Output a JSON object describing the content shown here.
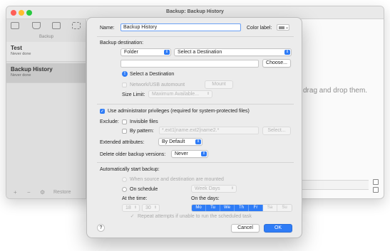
{
  "window": {
    "title": "Backup: Backup History",
    "sidebar_group": "Backup",
    "items": [
      {
        "name": "Test",
        "status": "Never done"
      },
      {
        "name": "Backup History",
        "status": "Never done"
      }
    ],
    "footer_restore": "Restore",
    "drop_hint": "drag and drop them.",
    "selected_color": "#c9c9c9"
  },
  "sheet": {
    "name_label": "Name:",
    "name_value": "Backup History",
    "color_label": "Color label:",
    "destination_label": "Backup destination:",
    "dest_type": "Folder",
    "dest_select": "Select a Destination",
    "path_value": "",
    "choose_button": "Choose...",
    "info_text": "Select a Destination",
    "network_label": "Network/USB automount",
    "mount_button": "Mount",
    "size_limit_label": "Size Limit:",
    "size_limit_value": "Maximum Available...",
    "admin_label": "Use administrator privileges (required for system-protected files)",
    "exclude_label": "Exclude:",
    "invisible_label": "Invisible files",
    "pattern_label": "By pattern:",
    "pattern_placeholder": "*.ext1|name.ext2|name2.*",
    "select_button": "Select...",
    "ext_attr_label": "Extended attributes:",
    "ext_attr_value": "By Default",
    "delete_label": "Delete older backup versions:",
    "delete_value": "Never",
    "auto_label": "Automatically start backup:",
    "when_mounted_label": "When source and destination are mounted",
    "on_schedule_label": "On schedule",
    "schedule_value": "Week Days",
    "at_time_label": "At the time:",
    "hour": "18",
    "minute": "30",
    "on_days_label": "On the days:",
    "days": [
      {
        "label": "Mo",
        "on": true
      },
      {
        "label": "Tu",
        "on": true
      },
      {
        "label": "We",
        "on": true
      },
      {
        "label": "Th",
        "on": true
      },
      {
        "label": "Fr",
        "on": true
      },
      {
        "label": "Sa",
        "on": false
      },
      {
        "label": "Su",
        "on": false
      }
    ],
    "repeat_label": "Repeat attempts if unable to run the scheduled task",
    "help": "?",
    "cancel_button": "Cancel",
    "ok_button": "OK"
  },
  "colors": {
    "accent": "#2f7cf6"
  }
}
